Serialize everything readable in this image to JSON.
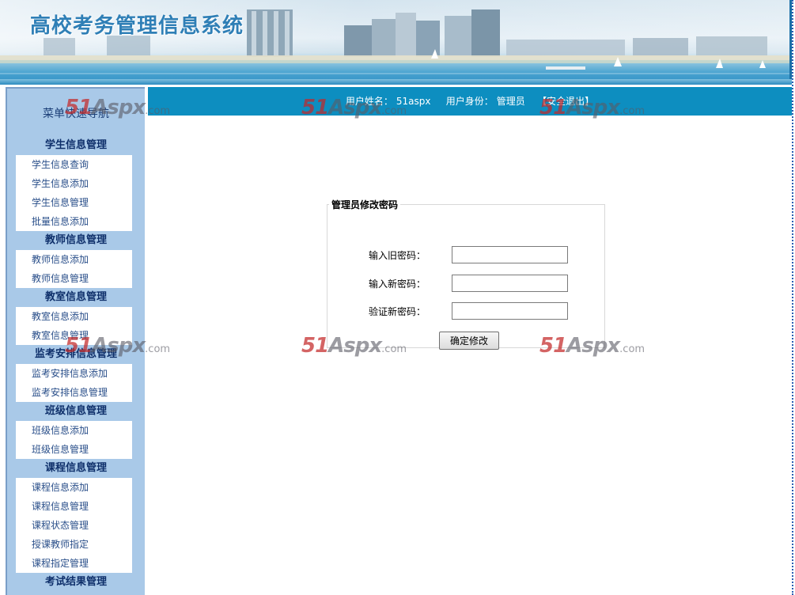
{
  "header": {
    "system_title": "高校考务管理信息系统"
  },
  "infobar": {
    "username_label": "用户姓名：",
    "username": "51aspx",
    "role_label": "用户身份：",
    "role": "管理员",
    "logout": "【安全退出】"
  },
  "sidebar": {
    "menu_title": "菜单快速导航",
    "categories": [
      {
        "title": "学生信息管理",
        "items": [
          "学生信息查询",
          "学生信息添加",
          "学生信息管理",
          "批量信息添加"
        ]
      },
      {
        "title": "教师信息管理",
        "items": [
          "教师信息添加",
          "教师信息管理"
        ]
      },
      {
        "title": "教室信息管理",
        "items": [
          "教室信息添加",
          "教室信息管理"
        ]
      },
      {
        "title": "监考安排信息管理",
        "items": [
          "监考安排信息添加",
          "监考安排信息管理"
        ]
      },
      {
        "title": "班级信息管理",
        "items": [
          "班级信息添加",
          "班级信息管理"
        ]
      },
      {
        "title": "课程信息管理",
        "items": [
          "课程信息添加",
          "课程信息管理",
          "课程状态管理",
          "授课教师指定",
          "课程指定管理"
        ]
      },
      {
        "title": "考试结果管理",
        "items": []
      }
    ]
  },
  "form": {
    "legend": "管理员修改密码",
    "old_password_label": "输入旧密码：",
    "old_password_value": "",
    "new_password_label": "输入新密码：",
    "new_password_value": "",
    "confirm_password_label": "验证新密码：",
    "confirm_password_value": "",
    "submit_label": "确定修改"
  },
  "watermark": {
    "brand": "51",
    "brand2": "Aspx",
    "suffix": ".com"
  }
}
